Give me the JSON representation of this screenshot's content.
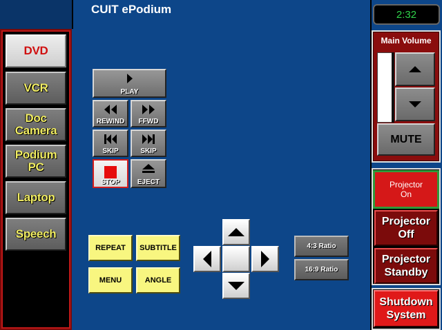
{
  "app": {
    "title": "CUIT ePodium",
    "clock": "2:32"
  },
  "sources": [
    {
      "label": "DVD",
      "active": true
    },
    {
      "label": "VCR",
      "active": false
    },
    {
      "label": "Doc\nCamera",
      "active": false
    },
    {
      "label": "Podium\nPC",
      "active": false
    },
    {
      "label": "Laptop",
      "active": false
    },
    {
      "label": "Speech",
      "active": false
    }
  ],
  "transport": {
    "play": "PLAY",
    "rewind": "REWIND",
    "ffwd": "FFWD",
    "skip_back": "SKIP",
    "skip_forward": "SKIP",
    "stop": "STOP",
    "eject": "EJECT"
  },
  "menu_buttons": {
    "repeat": "REPEAT",
    "subtitle": "SUBTITLE",
    "menu": "MENU",
    "angle": "ANGLE"
  },
  "ratio": {
    "r43": "4:3 Ratio",
    "r169": "16:9 Ratio"
  },
  "volume": {
    "title": "Main Volume",
    "mute": "MUTE",
    "level": 0.0
  },
  "projector": {
    "on": "Projector\nOn",
    "off": "Projector\nOff",
    "standby": "Projector\nStandby"
  },
  "system": {
    "shutdown": "Shutdown\nSystem"
  },
  "colors": {
    "background": "#0d4689",
    "accent_yellow": "#f2ee64",
    "alert_red": "#d51818",
    "clock_green": "#2fd34a"
  }
}
